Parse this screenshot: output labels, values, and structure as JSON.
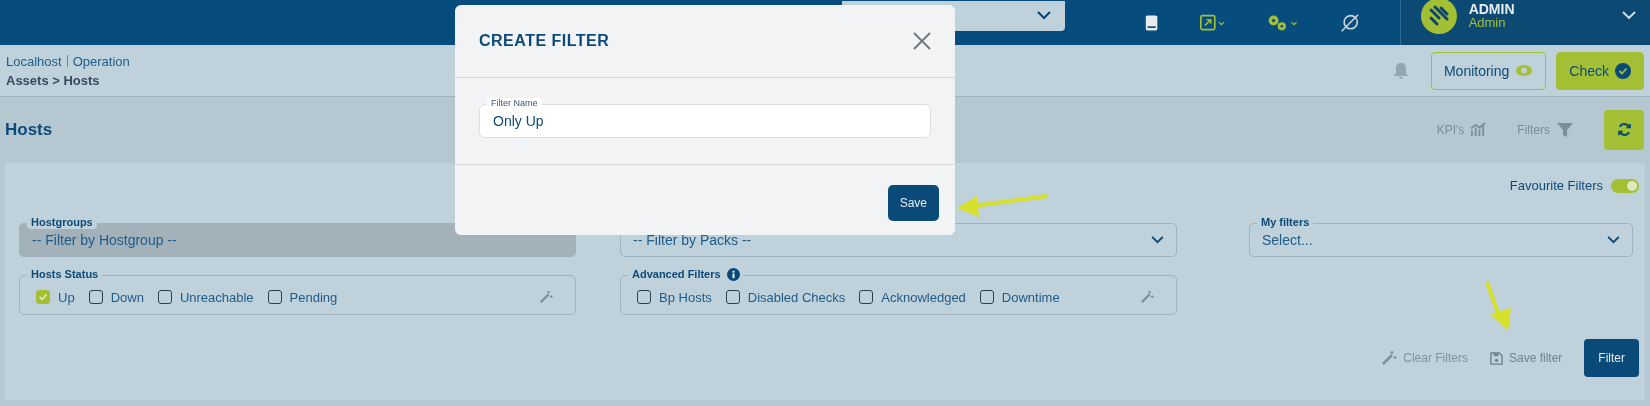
{
  "top_bar": {
    "user": {
      "name": "ADMIN",
      "role": "Admin"
    }
  },
  "breadcrumb": {
    "items": [
      "Localhost",
      "Operation"
    ],
    "path": "Assets > Hosts"
  },
  "header_buttons": [
    {
      "label": "Monitoring",
      "kind": "outline"
    },
    {
      "label": "Check",
      "kind": "filled"
    }
  ],
  "page": {
    "title": "Hosts",
    "actions": [
      "KPI's",
      "Filters"
    ]
  },
  "filters": {
    "favourite": {
      "label": "Favourite Filters",
      "on": true
    },
    "hostgroups": {
      "label": "Hostgroups",
      "placeholder": "-- Filter by Hostgroup --",
      "disabled": true
    },
    "packs": {
      "placeholder": "-- Filter by Packs --",
      "disabled": false
    },
    "my_filters": {
      "label": "My filters",
      "placeholder": "Select..."
    },
    "hosts_status": {
      "label": "Hosts Status",
      "options": [
        {
          "label": "Up",
          "checked": true
        },
        {
          "label": "Down",
          "checked": false
        },
        {
          "label": "Unreachable",
          "checked": false
        },
        {
          "label": "Pending",
          "checked": false
        }
      ]
    },
    "advanced": {
      "label": "Advanced Filters",
      "options": [
        {
          "label": "Bp Hosts",
          "checked": false
        },
        {
          "label": "Disabled Checks",
          "checked": false
        },
        {
          "label": "Acknowledged",
          "checked": false
        },
        {
          "label": "Downtime",
          "checked": false
        }
      ]
    },
    "actions": [
      {
        "label": "Clear Filters",
        "kind": "clear",
        "disabled": true
      },
      {
        "label": "Save filter",
        "kind": "save",
        "disabled": false
      },
      {
        "label": "Filter",
        "kind": "primary",
        "disabled": false
      }
    ]
  },
  "modal": {
    "title": "CREATE FILTER",
    "field": {
      "label": "Filter Name",
      "value": "Only Up"
    },
    "button": "Save"
  }
}
